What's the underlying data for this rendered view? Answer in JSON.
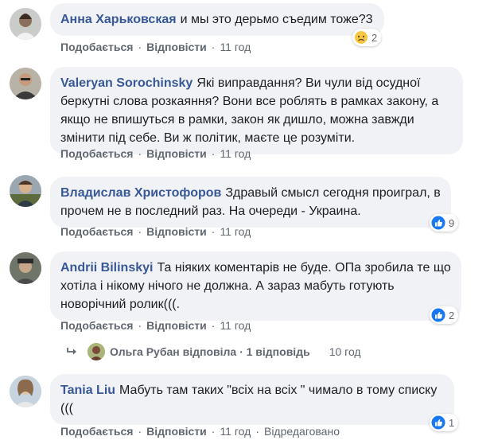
{
  "comments": [
    {
      "author": "Анна Харьковская",
      "text": "и мы это дерьмо съедим тоже?3",
      "actions": {
        "like": "Подобається",
        "reply": "Відповісти",
        "time": "11 год"
      },
      "reaction": {
        "icon": "sad-emoji-icon",
        "count": "2"
      }
    },
    {
      "author": "Valeryan Sorochinsky",
      "text": "Які виправдання? Ви чули від осудної беркутні слова розкаяння? Вони все роблять в рамках закону, а якщо не впишуться в рамки, закон як дишло, можна завжди змінити під себе. Ви ж політик, маєте це розуміти.",
      "actions": {
        "like": "Подобається",
        "reply": "Відповісти",
        "time": "11 год"
      }
    },
    {
      "author": "Владислав Христофоров",
      "text": "Здравый смысл сегодня проиграл, в прочем не в последний раз. На очереди - Украина.",
      "actions": {
        "like": "Подобається",
        "reply": "Відповісти",
        "time": "11 год"
      },
      "reaction": {
        "icon": "like-icon",
        "count": "9"
      }
    },
    {
      "author": "Andrii Bilinskyi",
      "text": "Та ніяких коментарів не буде. ОПа зробила те що хотіла і нікому нічого не должна. А зараз мабуть готують новорічний ролик(((.",
      "actions": {
        "like": "Подобається",
        "reply": "Відповісти",
        "time": "11 год"
      },
      "reaction": {
        "icon": "like-icon",
        "count": "2"
      },
      "replies": {
        "text": "Ольга Рубан відповіла · 1 відповідь",
        "time": "10 год"
      }
    },
    {
      "author": "Tania Liu",
      "text": "Мабуть там таких \"всіх на всіх \" чимало в тому списку (((",
      "actions": {
        "like": "Подобається",
        "reply": "Відповісти",
        "time": "11 год",
        "edited": "Відредаговано"
      },
      "reaction": {
        "icon": "like-icon",
        "count": "1"
      }
    }
  ],
  "colors": {
    "author": "#385898",
    "bubble": "#f0f2f5",
    "meta": "#606770",
    "like": "#1877f2"
  }
}
